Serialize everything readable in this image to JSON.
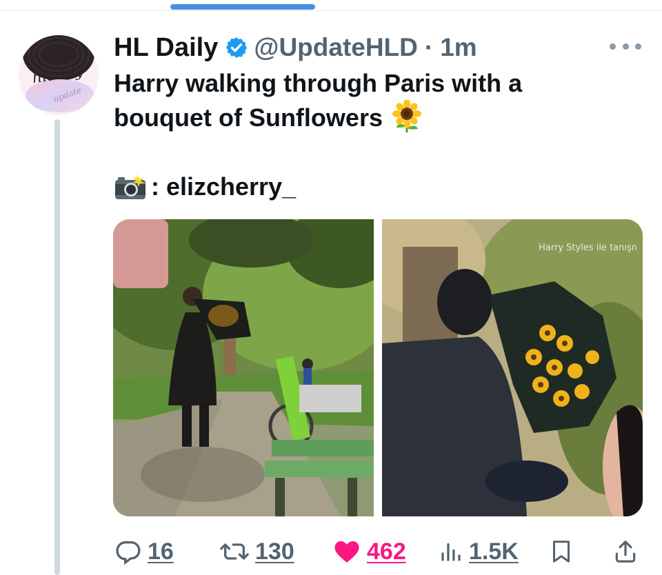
{
  "tweet": {
    "author": {
      "display_name": "HL Daily",
      "handle": "@UpdateHLD",
      "verified": true,
      "avatar_text_main": "hldaily",
      "avatar_text_sub": "update"
    },
    "separator": "·",
    "time": "1m",
    "text_line1": "Harry walking through Paris with a",
    "text_line2": "bouquet of Sunflowers",
    "credit_text": ": elizcherry_",
    "media": {
      "watermark": "Harry Styles ile tanışn"
    },
    "stats": {
      "replies": "16",
      "retweets": "130",
      "likes": "462",
      "views": "1.5K"
    }
  },
  "colors": {
    "accent": "#4a90e2",
    "like": "#f91880",
    "verified": "#1d9bf0",
    "muted": "#536471"
  },
  "icons": {
    "reply": "reply-icon",
    "retweet": "retweet-icon",
    "like": "heart-icon",
    "views": "views-icon",
    "bookmark": "bookmark-icon",
    "share": "share-icon",
    "more": "more-icon",
    "verified": "verified-badge-icon",
    "emoji_sunflower": "sunflower-emoji-icon",
    "emoji_camera": "camera-flash-emoji-icon"
  }
}
